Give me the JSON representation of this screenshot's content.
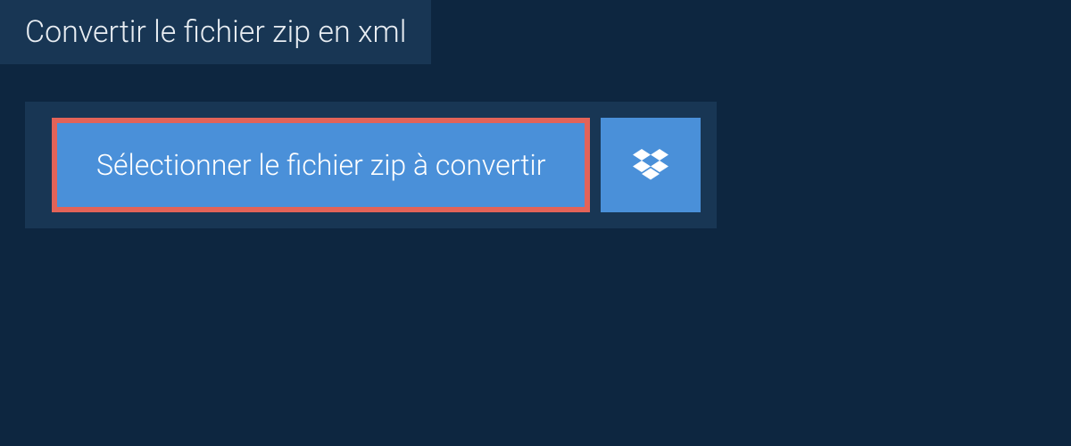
{
  "title": "Convertir le fichier zip en xml",
  "selectButton": {
    "label": "Sélectionner le fichier zip à convertir"
  }
}
